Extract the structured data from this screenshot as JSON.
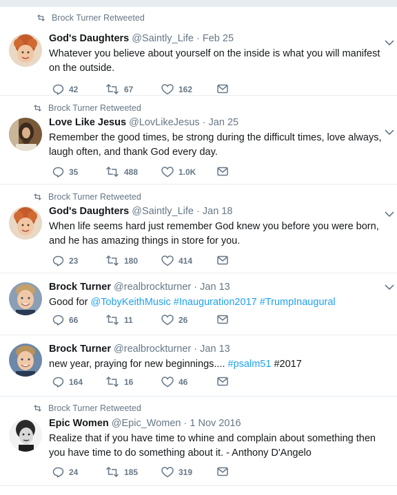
{
  "tweets": [
    {
      "retweet_context": "Brock Turner Retweeted",
      "name": "God's Daughters",
      "handle": "@Saintly_Life",
      "sep": "·",
      "date": "Feb 25",
      "text": "Whatever you believe about yourself on the inside is what you will manifest on the outside.",
      "replies": "42",
      "retweets": "67",
      "likes": "162",
      "avatar": "child-with-red-curly-hair"
    },
    {
      "retweet_context": "Brock Turner Retweeted",
      "name": "Love Like Jesus",
      "handle": "@LovLikeJesus",
      "sep": "·",
      "date": "Jan 25",
      "text": "Remember the good times, be strong during the difficult times, love always, laugh often, and thank God every day.",
      "replies": "35",
      "retweets": "488",
      "likes": "1.0K",
      "avatar": "jesus-portrait"
    },
    {
      "retweet_context": "Brock Turner Retweeted",
      "name": "God's Daughters",
      "handle": "@Saintly_Life",
      "sep": "·",
      "date": "Jan 18",
      "text": "When life seems hard just remember God knew you before you were born, and he has amazing things in store for you.",
      "replies": "23",
      "retweets": "180",
      "likes": "414",
      "avatar": "child-with-red-curly-hair"
    },
    {
      "name": "Brock Turner",
      "handle": "@realbrockturner",
      "sep": "·",
      "date": "Jan 13",
      "text_prefix": "Good for",
      "mentions": [
        "@TobyKeithMusic",
        "#Inauguration2017",
        "#TrumpInaugural"
      ],
      "replies": "66",
      "retweets": "11",
      "likes": "26",
      "avatar": "young-man-portrait"
    },
    {
      "name": "Brock Turner",
      "handle": "@realbrockturner",
      "sep": "·",
      "date": "Jan 13",
      "text_prefix": "new year, praying for new beginnings....",
      "hashtag_link": "#psalm51",
      "hashtag_plain": "#2017",
      "replies": "164",
      "retweets": "16",
      "likes": "46",
      "avatar": "young-man-portrait"
    },
    {
      "retweet_context": "Brock Turner Retweeted",
      "name": "Epic Women",
      "handle": "@Epic_Women",
      "sep": "·",
      "date": "1 Nov 2016",
      "text": "Realize that if you have time to whine and complain about something then you have time to do something about it. - Anthony D'Angelo",
      "replies": "24",
      "retweets": "185",
      "likes": "319",
      "avatar": "black-and-white-woman-portrait"
    }
  ],
  "colors": {
    "muted": "#657786",
    "link": "#1da1f2",
    "divider": "#e6ecf0",
    "text": "#14171a"
  },
  "icons": [
    "retweet-icon",
    "reply-icon",
    "like-icon",
    "message-icon",
    "chevron-down-icon"
  ]
}
